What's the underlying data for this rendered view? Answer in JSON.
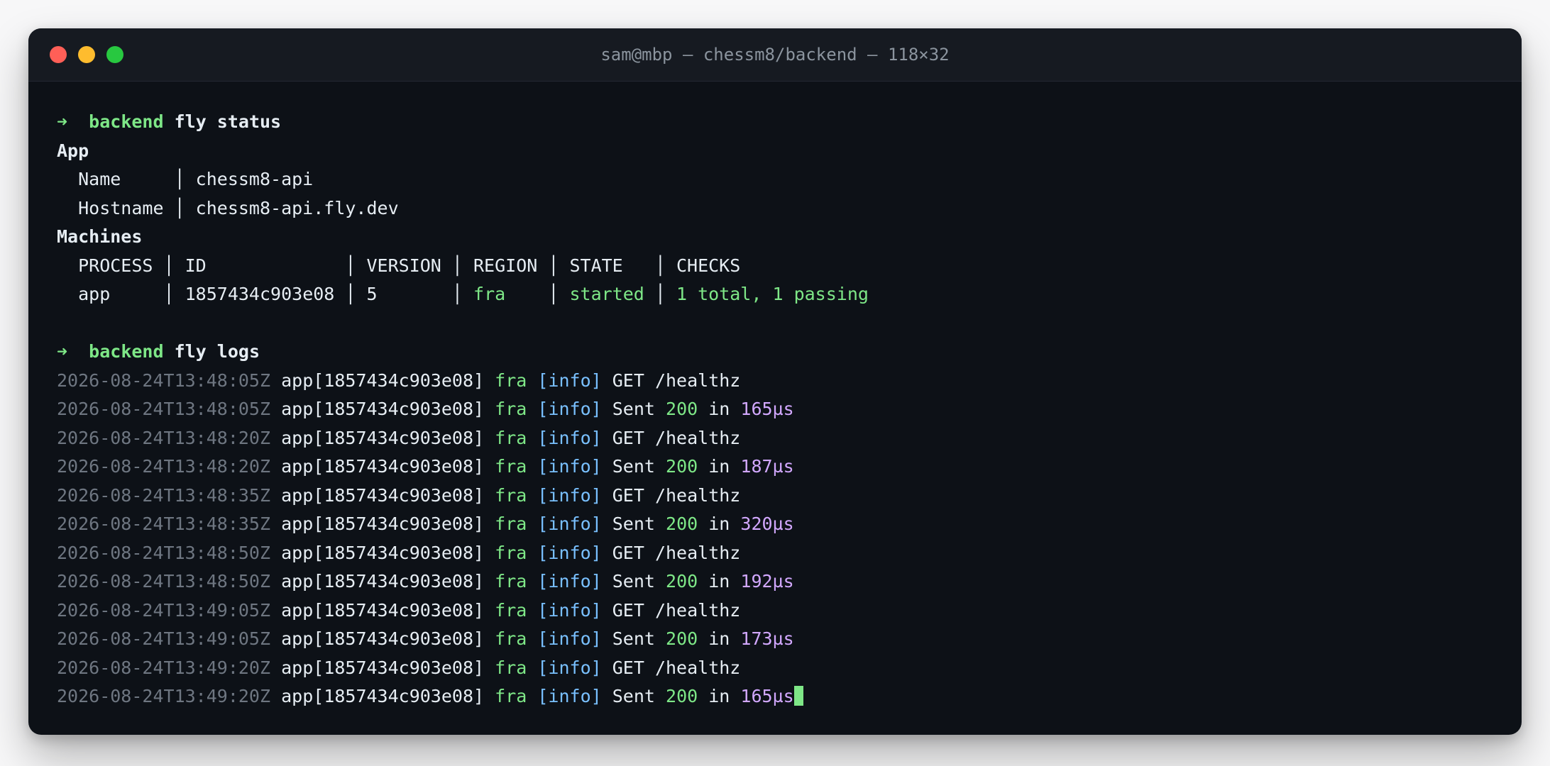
{
  "window": {
    "title": "sam@mbp — chessm8/backend — 118×32"
  },
  "commands": [
    {
      "arrow": "➜",
      "dir": "backend",
      "command": "fly status"
    },
    {
      "arrow": "➜",
      "dir": "backend",
      "command": "fly logs"
    }
  ],
  "status": {
    "app_heading": "App",
    "app_rows": [
      "  Name     │ chessm8-api",
      "  Hostname │ chessm8-api.fly.dev"
    ],
    "machines_heading": "Machines",
    "machines_header": "  PROCESS │ ID             │ VERSION │ REGION │ STATE   │ CHECKS",
    "machine_row": {
      "process": "  app     │ ",
      "id": "1857434c903e08",
      "sep1": " │ ",
      "version": "5      ",
      "sep2": " │ ",
      "region": "fra   ",
      "sep3": " │ ",
      "state": "started",
      "sep4": " │ ",
      "checks": "1 total, 1 passing"
    }
  },
  "logs": [
    {
      "ts": "2026-08-24T13:48:05Z",
      "src": "app[1857434c903e08]",
      "region": "fra",
      "level": "[info]",
      "kind": "get",
      "msg": "GET /healthz"
    },
    {
      "ts": "2026-08-24T13:48:05Z",
      "src": "app[1857434c903e08]",
      "region": "fra",
      "level": "[info]",
      "kind": "sent",
      "sent": "Sent",
      "status": "200",
      "in": "in",
      "duration": "165µs"
    },
    {
      "ts": "2026-08-24T13:48:20Z",
      "src": "app[1857434c903e08]",
      "region": "fra",
      "level": "[info]",
      "kind": "get",
      "msg": "GET /healthz"
    },
    {
      "ts": "2026-08-24T13:48:20Z",
      "src": "app[1857434c903e08]",
      "region": "fra",
      "level": "[info]",
      "kind": "sent",
      "sent": "Sent",
      "status": "200",
      "in": "in",
      "duration": "187µs"
    },
    {
      "ts": "2026-08-24T13:48:35Z",
      "src": "app[1857434c903e08]",
      "region": "fra",
      "level": "[info]",
      "kind": "get",
      "msg": "GET /healthz"
    },
    {
      "ts": "2026-08-24T13:48:35Z",
      "src": "app[1857434c903e08]",
      "region": "fra",
      "level": "[info]",
      "kind": "sent",
      "sent": "Sent",
      "status": "200",
      "in": "in",
      "duration": "320µs"
    },
    {
      "ts": "2026-08-24T13:48:50Z",
      "src": "app[1857434c903e08]",
      "region": "fra",
      "level": "[info]",
      "kind": "get",
      "msg": "GET /healthz"
    },
    {
      "ts": "2026-08-24T13:48:50Z",
      "src": "app[1857434c903e08]",
      "region": "fra",
      "level": "[info]",
      "kind": "sent",
      "sent": "Sent",
      "status": "200",
      "in": "in",
      "duration": "192µs"
    },
    {
      "ts": "2026-08-24T13:49:05Z",
      "src": "app[1857434c903e08]",
      "region": "fra",
      "level": "[info]",
      "kind": "get",
      "msg": "GET /healthz"
    },
    {
      "ts": "2026-08-24T13:49:05Z",
      "src": "app[1857434c903e08]",
      "region": "fra",
      "level": "[info]",
      "kind": "sent",
      "sent": "Sent",
      "status": "200",
      "in": "in",
      "duration": "173µs"
    },
    {
      "ts": "2026-08-24T13:49:20Z",
      "src": "app[1857434c903e08]",
      "region": "fra",
      "level": "[info]",
      "kind": "get",
      "msg": "GET /healthz"
    },
    {
      "ts": "2026-08-24T13:49:20Z",
      "src": "app[1857434c903e08]",
      "region": "fra",
      "level": "[info]",
      "kind": "sent",
      "sent": "Sent",
      "status": "200",
      "in": "in",
      "duration": "165µs"
    }
  ],
  "colors": {
    "background": "#0d1117",
    "titlebar": "#161a21",
    "text": "#e6edf3",
    "green": "#7ee787",
    "blue": "#79c0ff",
    "purple": "#d2a8ff",
    "dim": "#6e7681"
  }
}
